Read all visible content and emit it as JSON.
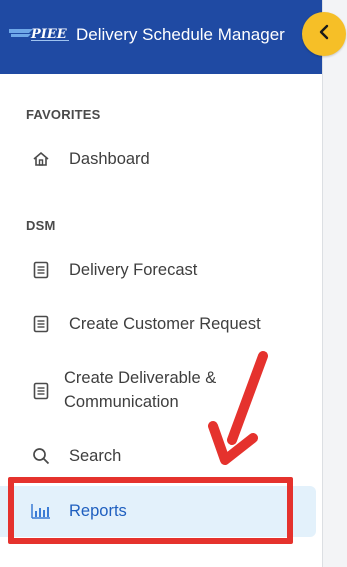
{
  "header": {
    "title": "Delivery Schedule Manager",
    "logo_text": "PIEE",
    "background_color": "#1f4aa3",
    "collapse_button_color": "#f6bf27",
    "collapse_icon": "chevron-left-icon"
  },
  "sections": [
    {
      "label": "FAVORITES",
      "items": [
        {
          "label": "Dashboard",
          "icon": "home-icon"
        }
      ]
    },
    {
      "label": "DSM",
      "items": [
        {
          "label": "Delivery Forecast",
          "icon": "document-icon"
        },
        {
          "label": "Create Customer Request",
          "icon": "document-icon"
        },
        {
          "label_line1": "Create Deliverable &",
          "label_line2": "Communication",
          "icon": "document-icon"
        },
        {
          "label": "Search",
          "icon": "search-icon"
        },
        {
          "label": "Reports",
          "icon": "bar-chart-icon",
          "active": true
        }
      ]
    }
  ],
  "annotation": {
    "highlight_color": "#e5322d",
    "arrow_color": "#e5322d",
    "target": "Reports"
  }
}
